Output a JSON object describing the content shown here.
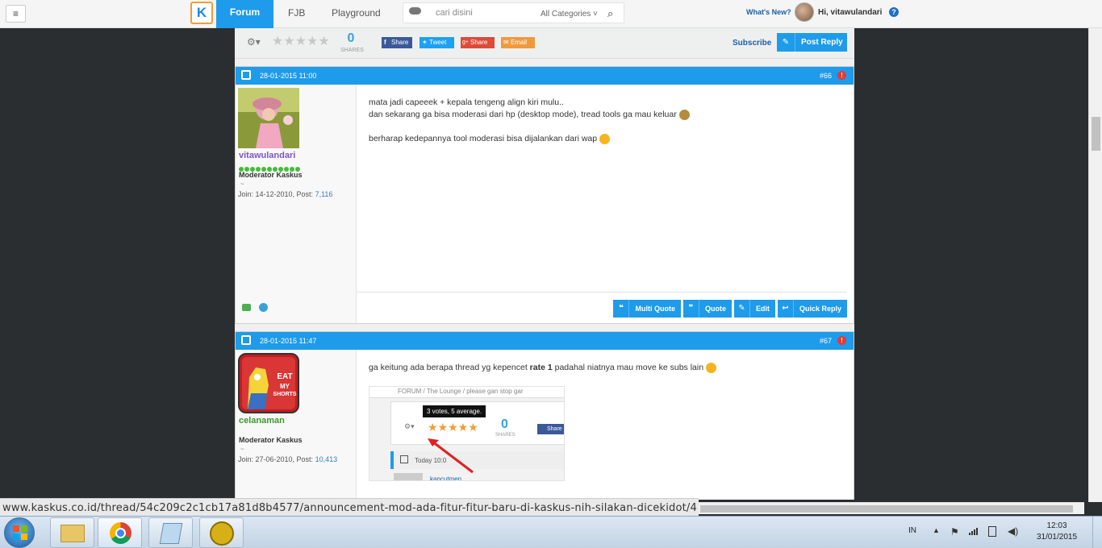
{
  "topnav": {
    "menu_icon": "hamburger-icon",
    "logo_letter": "K",
    "tabs": [
      {
        "label": "Forum",
        "active": true
      },
      {
        "label": "FJB",
        "active": false
      },
      {
        "label": "Playground",
        "active": false
      }
    ],
    "search": {
      "placeholder": "cari disini",
      "category": "All Categories ˅"
    },
    "whats_new": "What's New?",
    "greeting": "Hi, vitawulandari",
    "help": "?"
  },
  "toolbar": {
    "shares_count": "0",
    "shares_label": "SHARES",
    "share_buttons": [
      "Share",
      "Tweet",
      "Share",
      "Email"
    ],
    "subscribe": "Subscribe",
    "post_reply": "Post Reply"
  },
  "posts": [
    {
      "date": "28-01-2015 11:00",
      "number": "#66",
      "username": "vitawulandari",
      "username_color": "#7b57c4",
      "role": "Moderator Kaskus",
      "tilde": "~",
      "join": "Join: 14-12-2010, Post: ",
      "post_count": "7,116",
      "lines": [
        "mata jadi capeeek + kepala tengeng align kiri mulu..",
        "dan sekarang ga bisa moderasi dari hp (desktop mode), tread tools ga mau keluar",
        "berharap kedepannya tool moderasi bisa dijalankan dari wap"
      ],
      "actions": [
        "Multi Quote",
        "Quote",
        "Edit",
        "Quick Reply"
      ]
    },
    {
      "date": "28-01-2015 11:47",
      "number": "#67",
      "username": "celanaman",
      "username_color": "#3c9a2e",
      "role": "Moderator Kaskus",
      "tilde": "~",
      "join": "Join: 27-06-2010, Post: ",
      "post_count": "10,413",
      "avatar_text": [
        "EAT",
        "MY",
        "SHORTS"
      ],
      "line_prefix": "ga keitung ada berapa thread yg kepencet ",
      "line_bold": "rate 1",
      "line_suffix": " padahal niatnya mau move ke subs lain",
      "embed": {
        "breadcrumb": "FORUM  /  The Lounge  /  please gan stop gar",
        "tooltip": "3 votes, 5 average.",
        "shares_count": "0",
        "shares_label": "SHARES",
        "share": "Share",
        "date": "Today 10:0",
        "user": "kancutmen"
      }
    }
  ],
  "status_url": "www.kaskus.co.id/thread/54c209c2c1cb17a81d8b4577/announcement-mod-ada-fitur-fitur-baru-di-kaskus-nih-silakan-dicekidot/4",
  "taskbar": {
    "apps": [
      "explorer-icon",
      "chrome-icon",
      "notepad-icon",
      "app-icon"
    ],
    "lang": "IN",
    "time": "12:03",
    "date": "31/01/2015"
  }
}
